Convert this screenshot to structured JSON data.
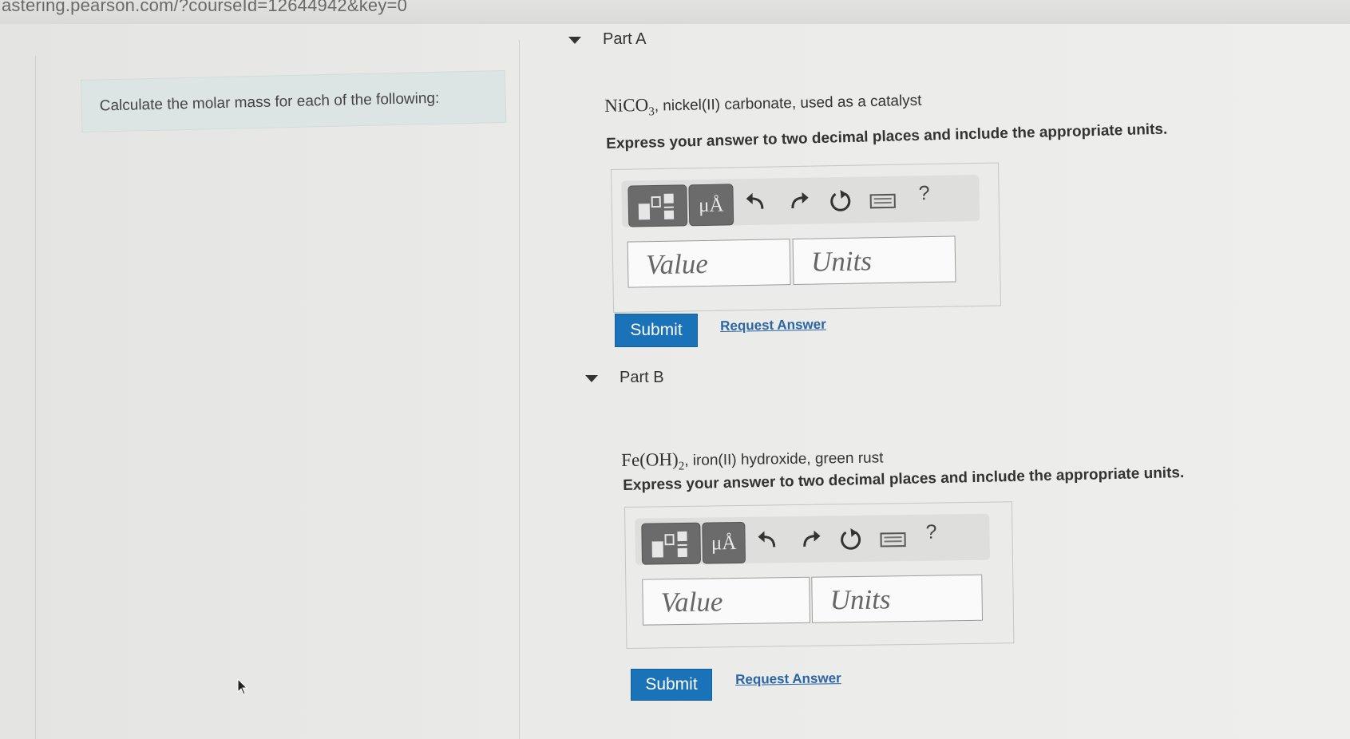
{
  "browser": {
    "url": "astering.pearson.com/?courseId=12644942&key=0"
  },
  "intro": {
    "text": "Calculate the molar mass for each of the following:"
  },
  "parts": [
    {
      "title": "Part A",
      "formula_main": "NiCO",
      "formula_sub": "3",
      "formula_after": "",
      "description": ", nickel(II) carbonate, used as a catalyst",
      "instruction": "Express your answer to two decimal places and include the appropriate units.",
      "value_placeholder": "Value",
      "units_placeholder": "Units",
      "submit_label": "Submit",
      "request_label": "Request Answer"
    },
    {
      "title": "Part B",
      "formula_main": "Fe(OH)",
      "formula_sub": "2",
      "formula_after": "",
      "description": ", iron(II) hydroxide, green rust",
      "instruction": "Express your answer to two decimal places and include the appropriate units.",
      "value_placeholder": "Value",
      "units_placeholder": "Units",
      "submit_label": "Submit",
      "request_label": "Request Answer"
    }
  ],
  "toolbar": {
    "units_glyph": "μÅ",
    "help_glyph": "?"
  }
}
